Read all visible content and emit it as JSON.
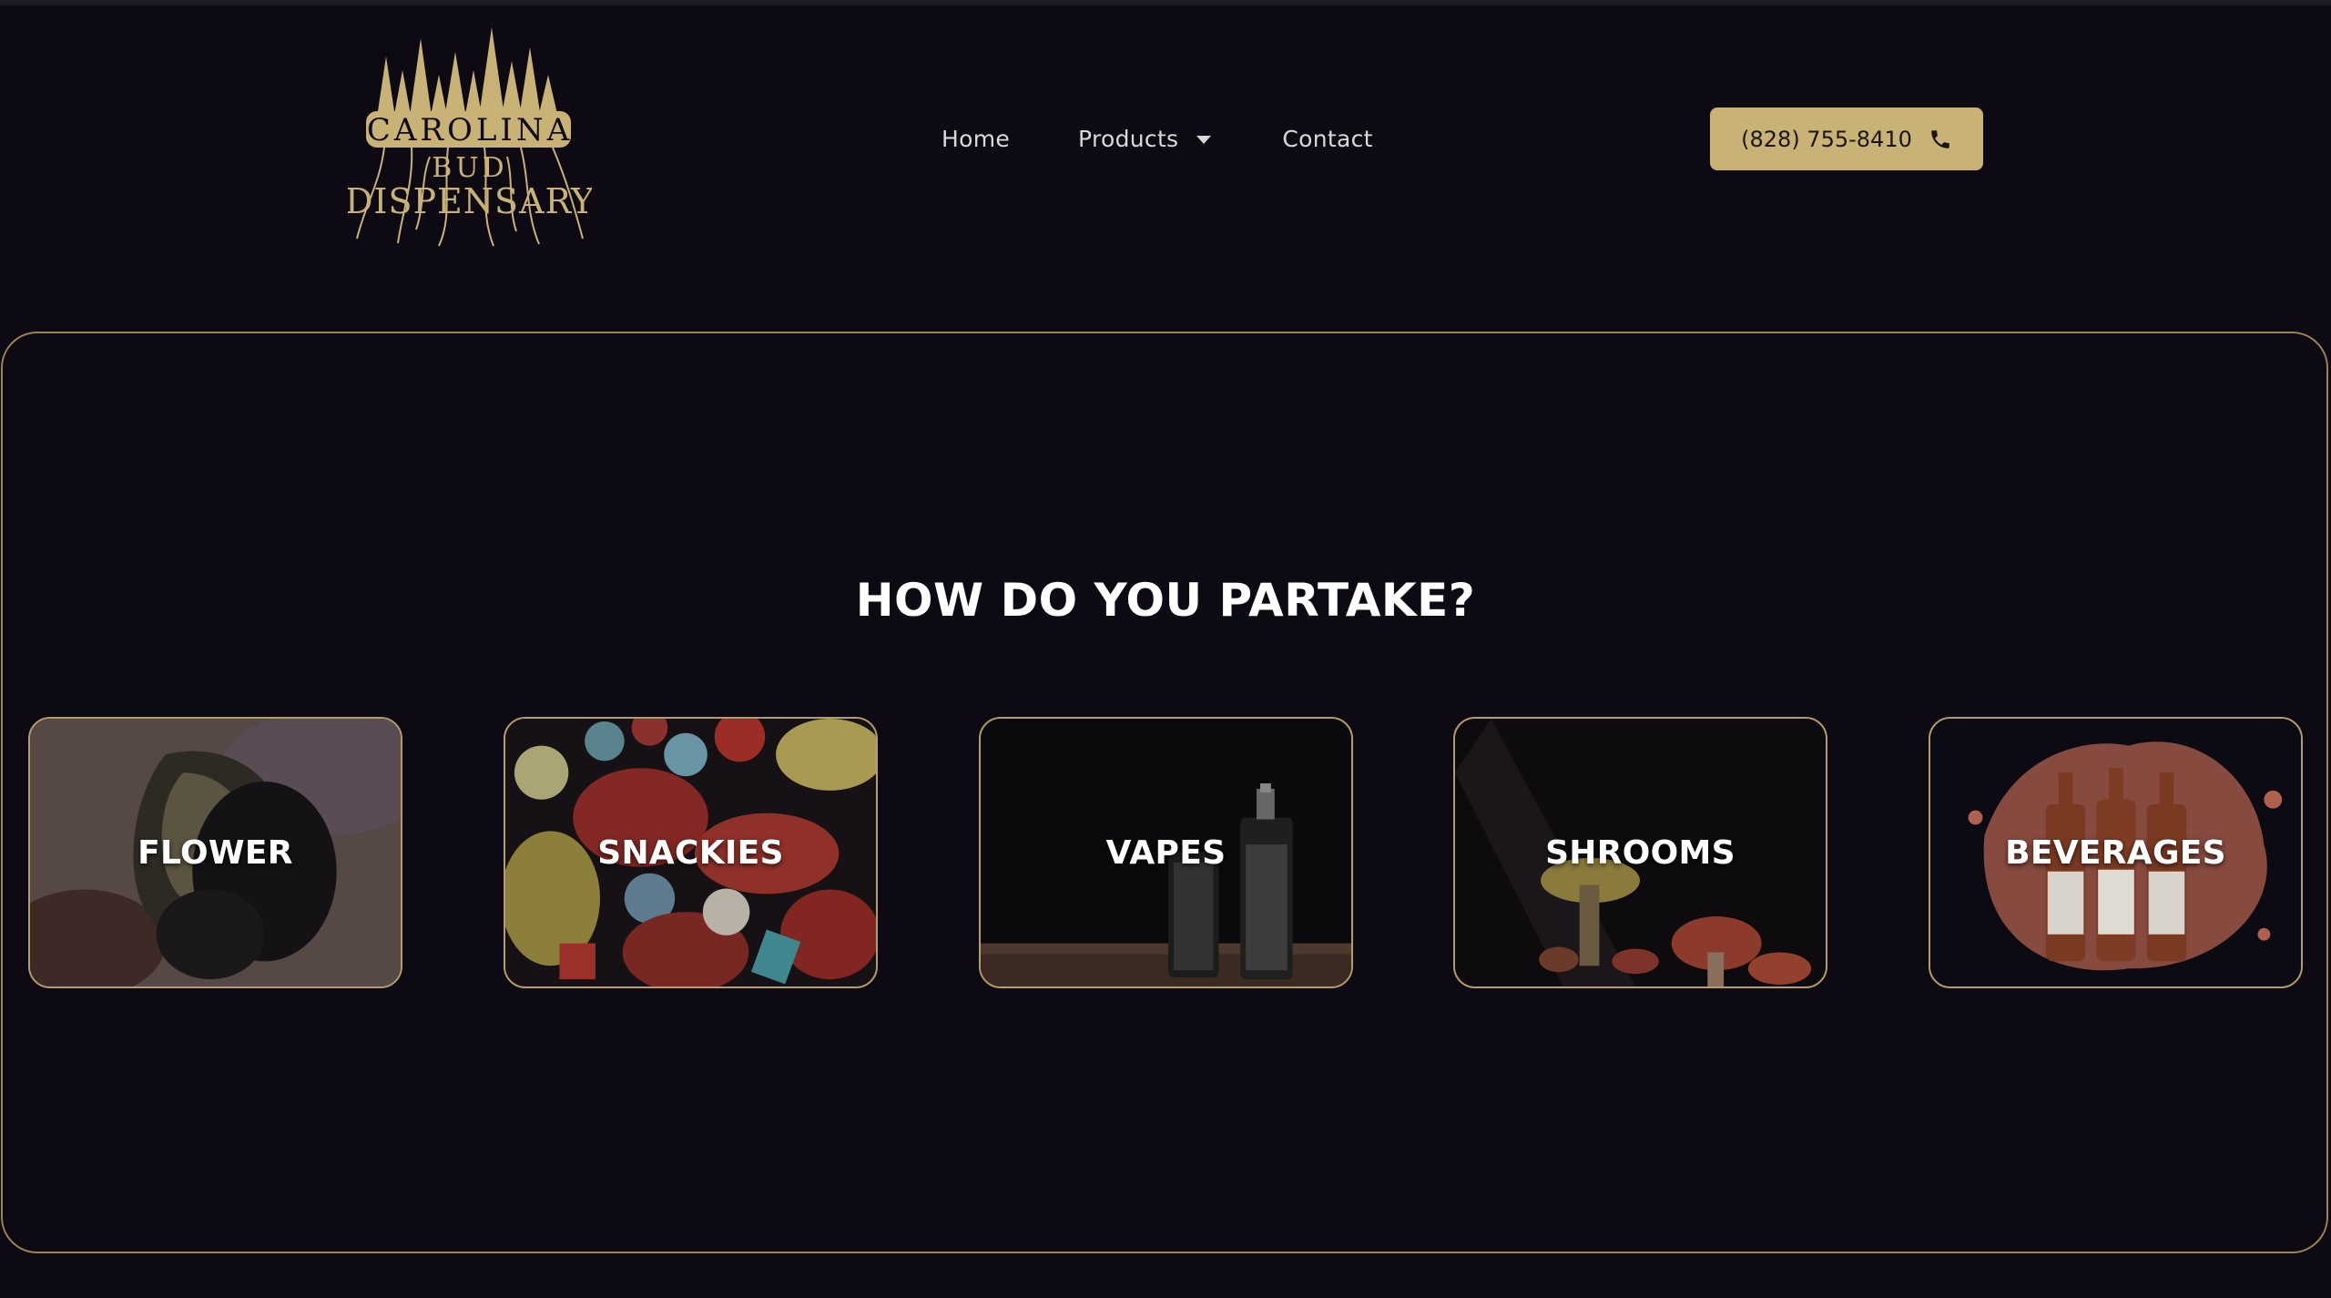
{
  "brand": {
    "logo_text_line1": "CAROLINA",
    "logo_text_line2": "BUD",
    "logo_text_line3": "DISPENSARY",
    "accent_color": "#c9b276",
    "background_color": "#0d0a14"
  },
  "nav": {
    "items": [
      {
        "label": "Home"
      },
      {
        "label": "Products",
        "has_dropdown": true
      },
      {
        "label": "Contact"
      }
    ]
  },
  "header": {
    "phone_label": "(828) 755-8410",
    "phone_icon": "phone-icon"
  },
  "main": {
    "heading": "HOW DO YOU PARTAKE?",
    "categories": [
      {
        "label": "FLOWER"
      },
      {
        "label": "SNACKIES"
      },
      {
        "label": "VAPES"
      },
      {
        "label": "SHROOMS"
      },
      {
        "label": "BEVERAGES"
      }
    ]
  }
}
